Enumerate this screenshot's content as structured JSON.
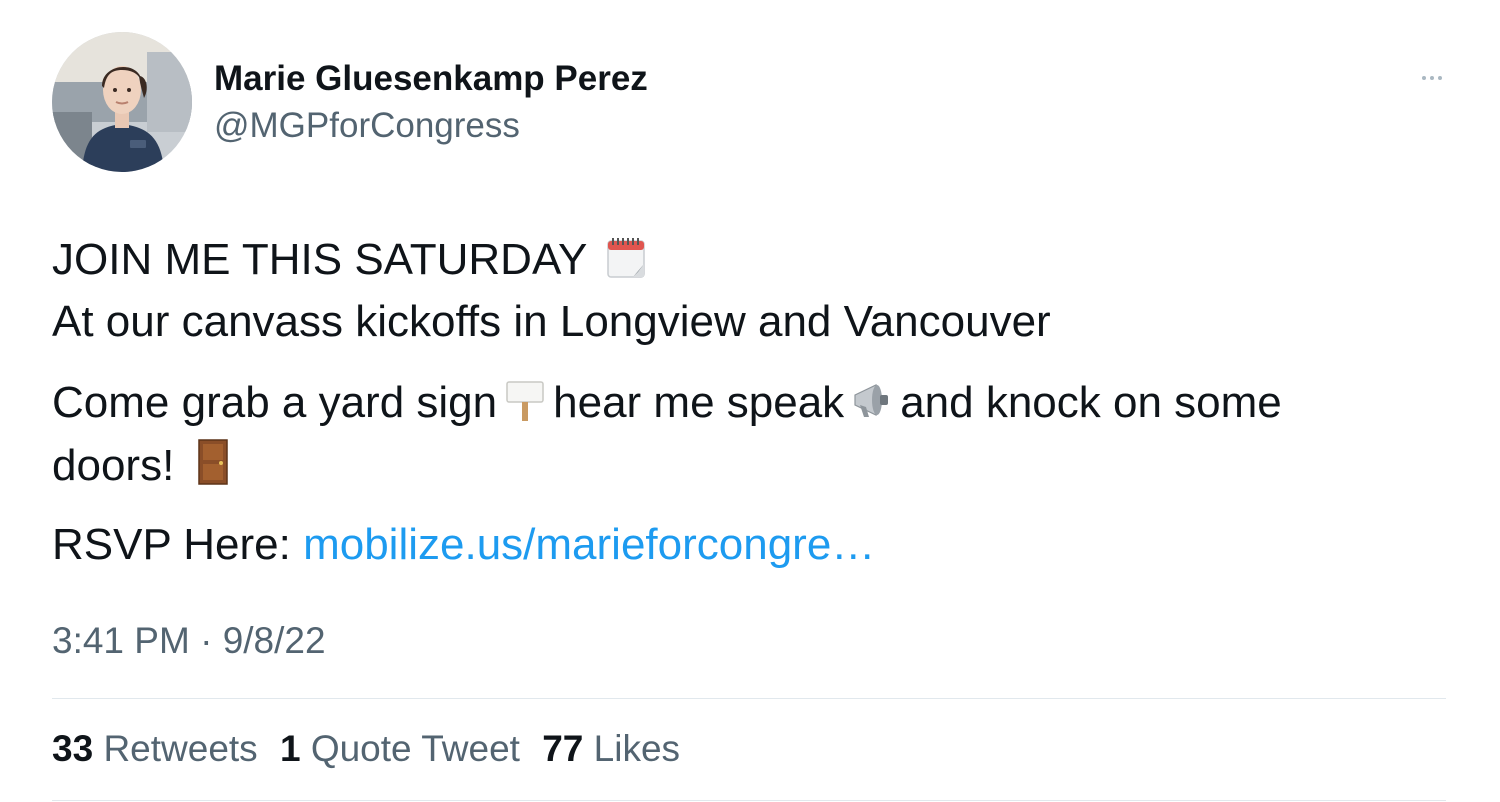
{
  "author": {
    "name": "Marie Gluesenkamp Perez",
    "handle": "@MGPforCongress"
  },
  "tweet": {
    "line1": "JOIN ME THIS SATURDAY",
    "line2": "At our canvass kickoffs in Longview and Vancouver",
    "line3_part1": "Come grab a yard sign",
    "line3_part2": "hear me speak",
    "line3_part3": "and knock on some",
    "line4": "doors!",
    "rsvp_label": "RSVP Here:",
    "link_text": "mobilize.us/marieforcongre…",
    "emojis": [
      "calendar-icon",
      "placard-icon",
      "megaphone-icon",
      "door-icon"
    ]
  },
  "meta": {
    "time": "3:41 PM",
    "separator": "·",
    "date": "9/8/22"
  },
  "stats": {
    "retweets_count": "33",
    "retweets_label": "Retweets",
    "quotes_count": "1",
    "quotes_label": "Quote Tweet",
    "likes_count": "77",
    "likes_label": "Likes"
  },
  "colors": {
    "text": "#0f1419",
    "secondary": "#536471",
    "link": "#1d9bf0",
    "divider": "#e1e8ed"
  }
}
